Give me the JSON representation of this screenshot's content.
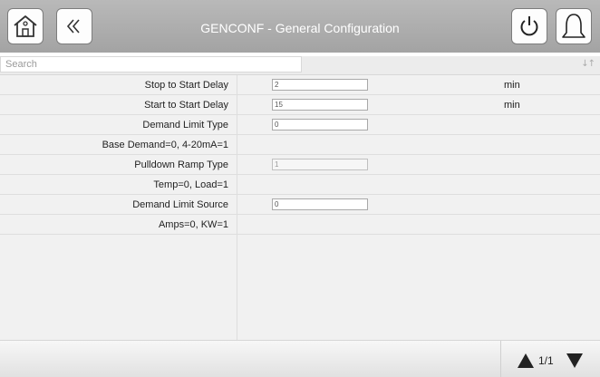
{
  "header": {
    "title": "GENCONF - General Configuration",
    "buttons": [
      "home-icon",
      "double-chevron-left-icon",
      "power-icon",
      "bell-icon"
    ]
  },
  "search": {
    "placeholder": "Search",
    "value": "",
    "sort_icon": "sort-icon"
  },
  "rows": [
    {
      "label": "Stop to Start Delay",
      "value": "2",
      "unit": "min"
    },
    {
      "label": "Start to Start Delay",
      "value": "15",
      "unit": "min"
    },
    {
      "label": "Demand Limit Type",
      "value": "0",
      "unit": ""
    },
    {
      "label": "Base Demand=0, 4-20mA=1",
      "value": null,
      "unit": ""
    },
    {
      "label": "Pulldown Ramp Type",
      "value": "1",
      "unit": ""
    },
    {
      "label": "Temp=0, Load=1",
      "value": null,
      "unit": ""
    },
    {
      "label": "Demand Limit Source",
      "value": "0",
      "unit": ""
    },
    {
      "label": "Amps=0, KW=1",
      "value": null,
      "unit": ""
    }
  ],
  "footer": {
    "page": "1/1"
  }
}
